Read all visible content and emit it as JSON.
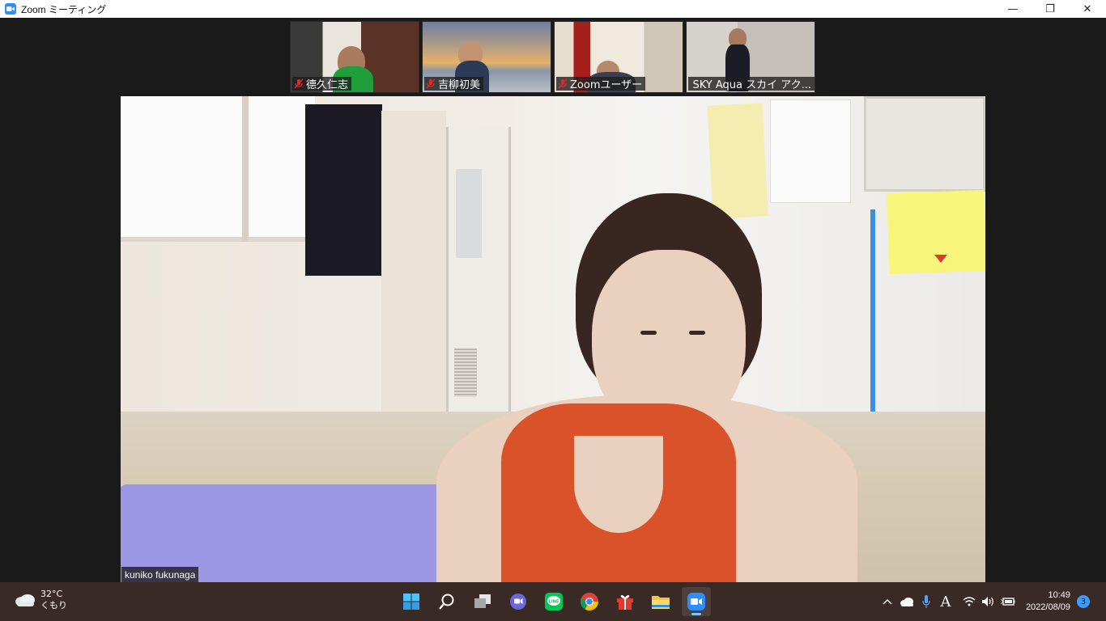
{
  "window": {
    "title": "Zoom ミーティング",
    "controls": {
      "minimize": "—",
      "restore": "❐",
      "close": "✕"
    }
  },
  "participants": [
    {
      "name": "德久仁志",
      "muted": true
    },
    {
      "name": "吉柳初美",
      "muted": true
    },
    {
      "name": "Zoomユーザー",
      "muted": true
    },
    {
      "name": "SKY Aqua スカイ アク...",
      "muted": true
    }
  ],
  "speaker": {
    "name": "kuniko fukunaga"
  },
  "taskbar": {
    "weather": {
      "temp": "32°C",
      "condition": "くもり"
    },
    "apps": [
      "start-icon",
      "search-icon",
      "task-view-icon",
      "teams-chat-icon",
      "line-icon",
      "chrome-icon",
      "gift-icon",
      "file-explorer-icon",
      "zoom-icon"
    ],
    "tray": {
      "ime": "A"
    },
    "clock": {
      "time": "10:49",
      "date": "2022/08/09"
    },
    "notifications": "3"
  },
  "colors": {
    "zoom_blue": "#2d8cff",
    "taskbar_bg": "#3a2a26",
    "meeting_bg": "#1a1a1a",
    "mute_red": "#e02828"
  }
}
